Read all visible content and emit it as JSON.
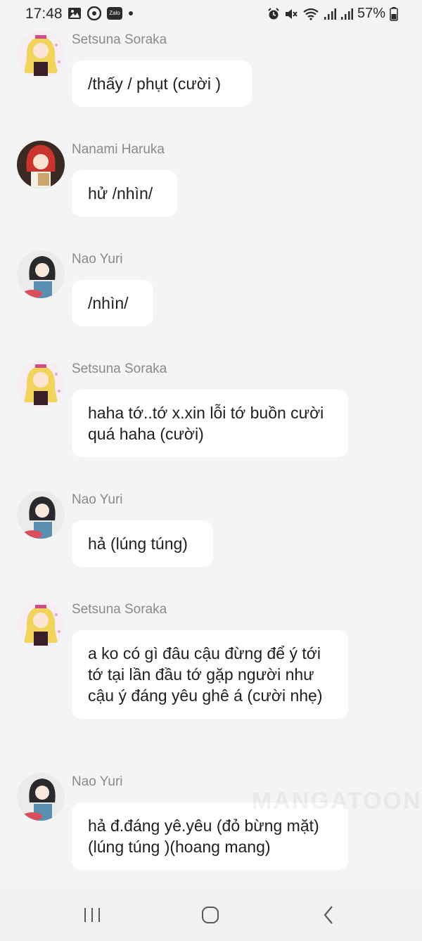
{
  "status_bar": {
    "time": "17:48",
    "left_icons": [
      "gallery-icon",
      "messenger-icon",
      "zalo-icon",
      "dot-icon"
    ],
    "zalo_label": "Zalo",
    "right_icons": [
      "alarm-icon",
      "mute-icon",
      "wifi-icon",
      "signal-icon",
      "signal-icon",
      "battery-icon"
    ],
    "battery": "57%"
  },
  "messages": [
    {
      "sender": "Setsuna Soraka",
      "text": "/thấy / phụt (cười )"
    },
    {
      "sender": "Nanami Haruka",
      "text": "hử /nhìn/"
    },
    {
      "sender": "Nao Yuri",
      "text": "/nhìn/"
    },
    {
      "sender": "Setsuna Soraka",
      "text": "haha tớ..tớ x.xin lỗi tớ buồn cười quá haha (cười)"
    },
    {
      "sender": "Nao Yuri",
      "text": "hả (lúng túng)"
    },
    {
      "sender": "Setsuna Soraka",
      "text": "a ko có gì đâu cậu đừng để ý tới tớ tại lần đầu tớ gặp người như cậu ý đáng yêu ghê á (cười nhẹ)"
    },
    {
      "sender": "Nao Yuri",
      "text": "hả đ.đáng yê.yêu (đỏ bừng mặt) (lúng túng )(hoang mang)"
    }
  ],
  "watermark": "MANGATOON",
  "nav_bar": {
    "icons": [
      "recent-apps-icon",
      "home-icon",
      "back-icon"
    ]
  },
  "colors": {
    "background": "#f3f4f6",
    "bubble": "#ffffff",
    "name": "#8a8a8a",
    "text": "#1f1f1f"
  }
}
